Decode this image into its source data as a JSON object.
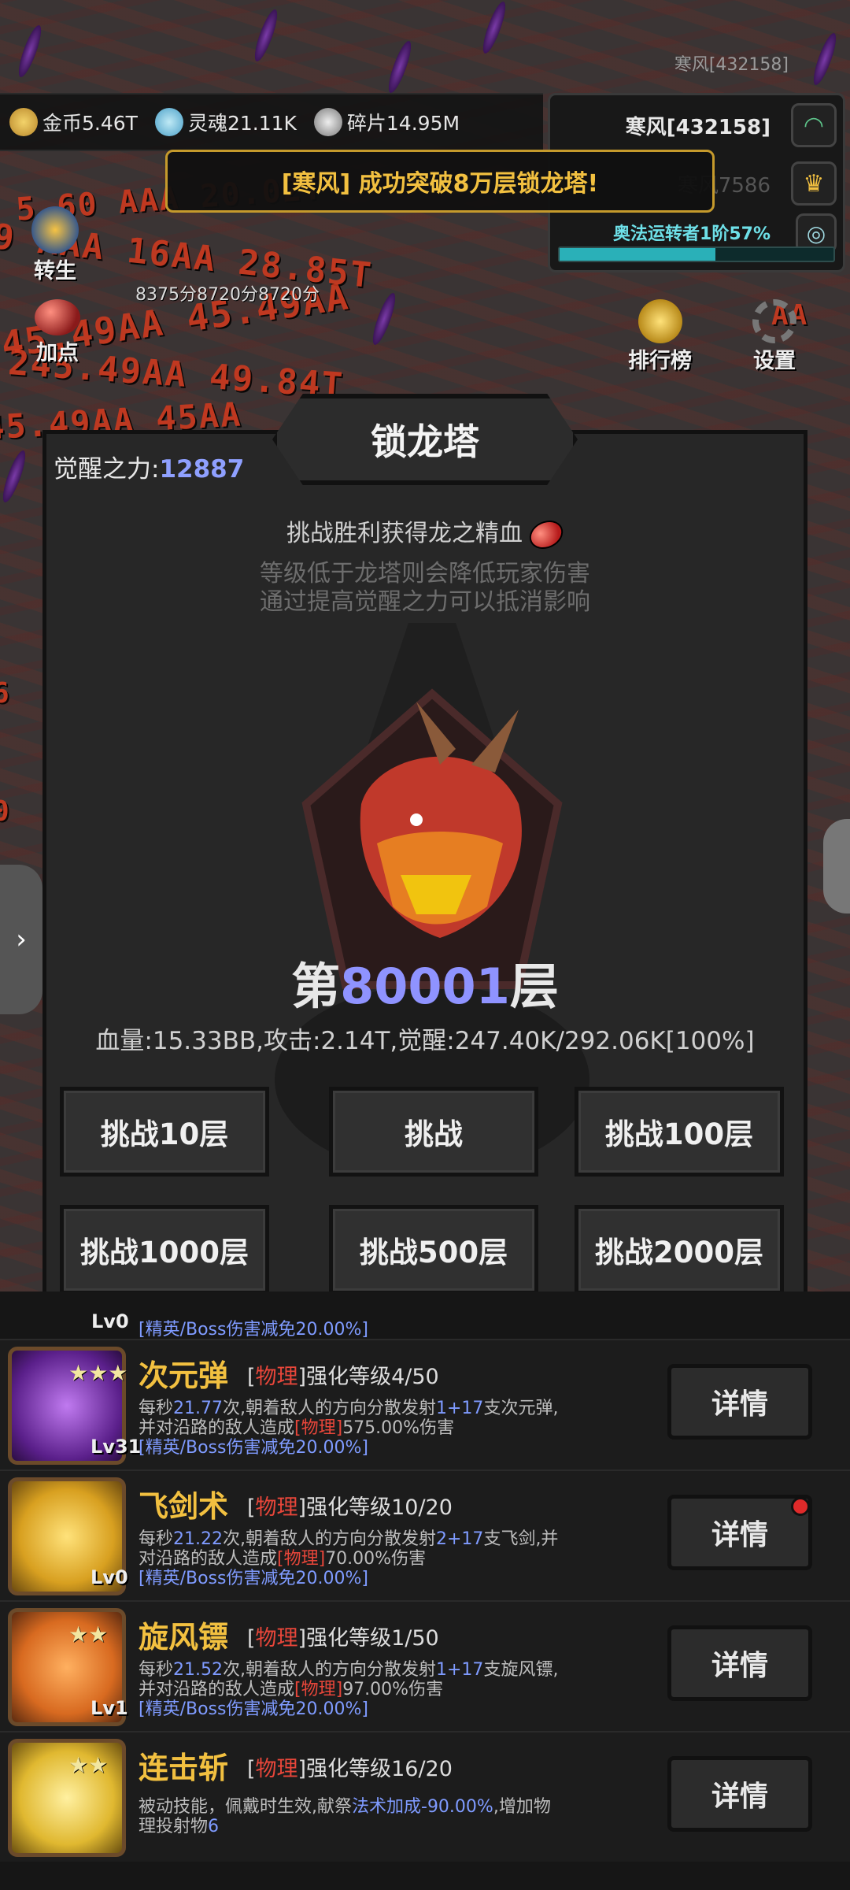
{
  "top": {
    "player_name": "寒风[432158]"
  },
  "resources": [
    {
      "icon": "gold-coin-icon",
      "label": "金币5.46T"
    },
    {
      "icon": "soul-icon",
      "label": "灵魂21.11K"
    },
    {
      "icon": "shard-icon",
      "label": "碎片14.95M"
    }
  ],
  "right_panel": {
    "name": "寒风[432158]",
    "secondary": "寒风7586",
    "rank_text": "奥法运转者1阶57%",
    "progress": 0.57
  },
  "banner": {
    "text": "[寒风] 成功突破8万层锁龙塔!"
  },
  "side": {
    "rebirth": "转生",
    "add_points": "加点",
    "leaderboard": "排行榜",
    "settings": "设置",
    "damage_line": "8375分8720分8720分"
  },
  "modal": {
    "title": "锁龙塔",
    "power_label": "觉醒之力:",
    "power_value": "12887",
    "reward": "挑战胜利获得龙之精血",
    "hint1": "等级低于龙塔则会降低玩家伤害",
    "hint2": "通过提高觉醒之力可以抵消影响",
    "floor_prefix": "第",
    "floor_number": "80001",
    "floor_suffix": "层",
    "stats": "血量:15.33BB,攻击:2.14T,觉醒:247.40K/292.06K[100%]",
    "buttons": [
      "挑战10层",
      "挑战",
      "挑战100层",
      "挑战1000层",
      "挑战500层",
      "挑战2000层"
    ]
  },
  "skills": {
    "partial_top": {
      "lv": "Lv0",
      "note": "[精英/Boss伤害减免20.00%]"
    },
    "list": [
      {
        "name": "次元弹",
        "tag_l": "[",
        "tag_type": "物理",
        "tag_r": "]",
        "level_text": "强化等级4/50",
        "lv": "Lv31",
        "d1": "每秒",
        "rate": "21.77",
        "d2": "次,朝着敌人的方向分散发射",
        "count": "1+17",
        "d3": "支次元弹,",
        "d4": "并对沿路的敌人造成",
        "dtype": "[物理]",
        "pct": "575.00%",
        "d5": "伤害",
        "note": "[精英/Boss伤害减免20.00%]",
        "detail": "详情"
      },
      {
        "name": "飞剑术",
        "tag_l": "[",
        "tag_type": "物理",
        "tag_r": "]",
        "level_text": "强化等级10/20",
        "lv": "Lv0",
        "d1": "每秒",
        "rate": "21.22",
        "d2": "次,朝着敌人的方向分散发射",
        "count": "2+17",
        "d3": "支飞剑,并",
        "d4": "对沿路的敌人造成",
        "dtype": "[物理]",
        "pct": "70.00%",
        "d5": "伤害",
        "note": "[精英/Boss伤害减免20.00%]",
        "detail": "详情"
      },
      {
        "name": "旋风镖",
        "tag_l": "[",
        "tag_type": "物理",
        "tag_r": "]",
        "level_text": "强化等级1/50",
        "lv": "Lv1",
        "d1": "每秒",
        "rate": "21.52",
        "d2": "次,朝着敌人的方向分散发射",
        "count": "1+17",
        "d3": "支旋风镖,",
        "d4": "并对沿路的敌人造成",
        "dtype": "[物理]",
        "pct": "97.00%",
        "d5": "伤害",
        "note": "[精英/Boss伤害减免20.00%]",
        "detail": "详情"
      }
    ],
    "last": {
      "name": "连击斩",
      "tag_type": "物理",
      "level_text": "强化等级16/20",
      "d1": "被动技能，佩戴时生效,献祭",
      "bonus": "法术加成-90.00%",
      "d2": ",增加物",
      "d3": "理投射物",
      "n": "6",
      "detail": "详情"
    }
  }
}
